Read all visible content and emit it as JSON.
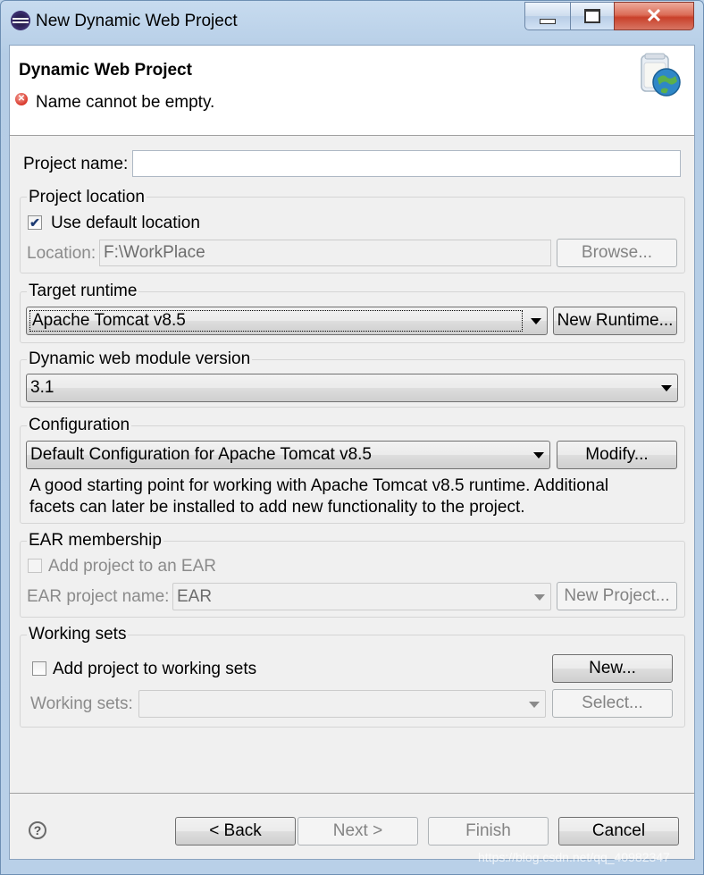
{
  "window": {
    "title": "New Dynamic Web Project",
    "close_glyph": "✕"
  },
  "header": {
    "title": "Dynamic Web Project",
    "error_message": "Name cannot be empty.",
    "error_icon": "error-icon",
    "banner_icon": "web-project-wizard-icon"
  },
  "project_name": {
    "label": "Project name:",
    "value": ""
  },
  "project_location": {
    "group_label": "Project location",
    "use_default_label": "Use default location",
    "use_default_checked": true,
    "location_label": "Location:",
    "location_value": "F:\\WorkPlace",
    "browse_label": "Browse..."
  },
  "target_runtime": {
    "group_label": "Target runtime",
    "selected": "Apache Tomcat v8.5",
    "new_runtime_label": "New Runtime..."
  },
  "module_version": {
    "group_label": "Dynamic web module version",
    "selected": "3.1"
  },
  "configuration": {
    "group_label": "Configuration",
    "selected": "Default Configuration for Apache Tomcat v8.5",
    "modify_label": "Modify...",
    "description_line1": "A good starting point for working with Apache Tomcat v8.5 runtime. Additional",
    "description_line2": "facets can later be installed to add new functionality to the project."
  },
  "ear": {
    "group_label": "EAR membership",
    "add_label": "Add project to an EAR",
    "add_checked": false,
    "name_label": "EAR project name:",
    "name_value": "EAR",
    "new_project_label": "New Project..."
  },
  "working_sets": {
    "group_label": "Working sets",
    "add_label": "Add project to working sets",
    "add_checked": false,
    "new_label": "New...",
    "sets_label": "Working sets:",
    "sets_value": "",
    "select_label": "Select..."
  },
  "footer": {
    "help_glyph": "?",
    "back_label": "< Back",
    "next_label": "Next >",
    "finish_label": "Finish",
    "cancel_label": "Cancel",
    "watermark": "https://blog.csdn.net/qq_40982347"
  },
  "colors": {
    "frame": "#bcd3ea",
    "client": "#f0f0f0",
    "error": "#d9382b",
    "close_button": "#c9402a"
  }
}
